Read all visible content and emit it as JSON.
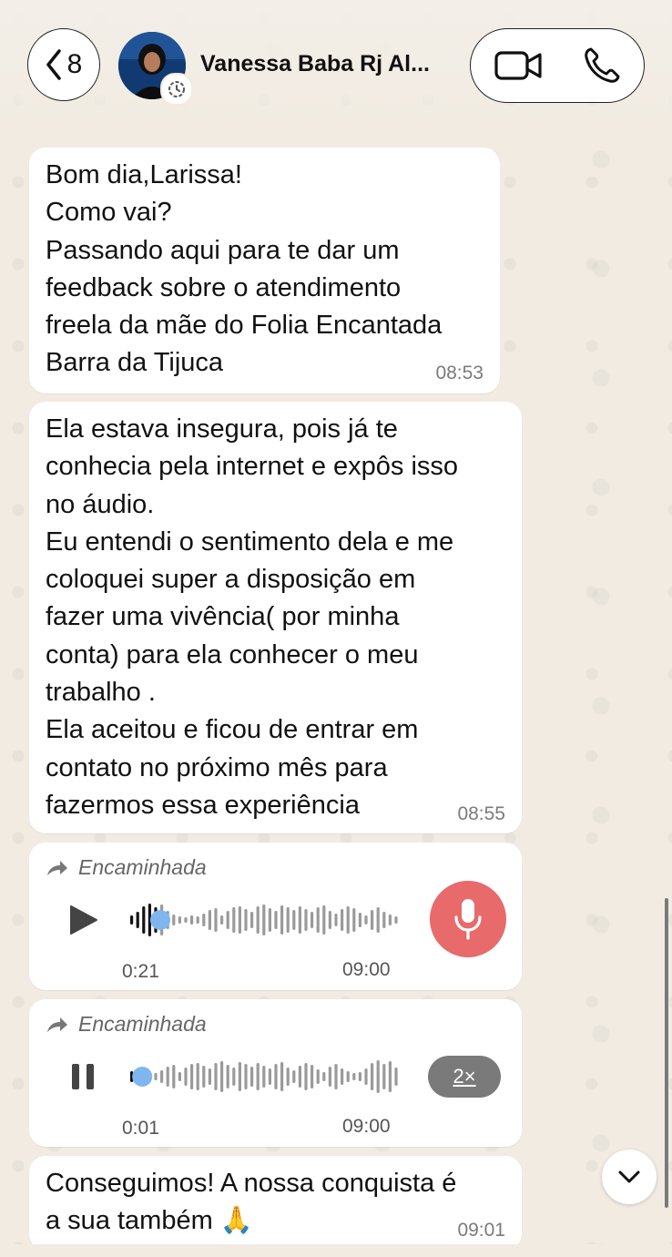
{
  "header": {
    "back_count": "8",
    "contact_name": "Vanessa Baba Rj Al..."
  },
  "messages": [
    {
      "text": "Bom dia,Larissa!\nComo vai?\nPassando aqui para te dar um\nfeedback sobre o atendimento\nfreela da mãe do Folia Encantada\nBarra da Tijuca",
      "time": "08:53"
    },
    {
      "text": "Ela estava insegura, pois já te\nconhecia pela internet e expôs isso\nno áudio.\nEu entendi o sentimento dela e me\ncoloquei super a disposição em\nfazer uma vivência( por minha\nconta) para ela conhecer o meu\ntrabalho .\nEla aceitou e ficou de entrar em\ncontato no próximo mês para\nfazermos essa experiência",
      "time": "08:55"
    }
  ],
  "audios": [
    {
      "forward_label": "Encaminhada",
      "duration": "0:21",
      "time": "09:00",
      "state": "paused",
      "progress": 0.1
    },
    {
      "forward_label": "Encaminhada",
      "duration": "0:01",
      "time": "09:00",
      "state": "playing",
      "speed": "2×",
      "progress": 0.05
    }
  ],
  "last_message": {
    "text": "Conseguimos! A nossa conquista é\na sua também 🙏",
    "time": "09:01"
  },
  "icons": {
    "back": "chevron-left-icon",
    "video": "video-camera-icon",
    "phone": "phone-icon",
    "forward": "forward-arrow-icon",
    "play": "play-icon",
    "pause": "pause-icon",
    "mic": "microphone-icon",
    "scroll_down": "chevron-down-icon"
  },
  "colors": {
    "background": "#f1ebe2",
    "bubble": "#ffffff",
    "mic_button": "#e86a6a",
    "wave_played": "#111111",
    "wave_unplayed": "#9a9a9a",
    "wave_thumb": "#7fb6f0",
    "speed_badge": "#7a7a7a"
  }
}
